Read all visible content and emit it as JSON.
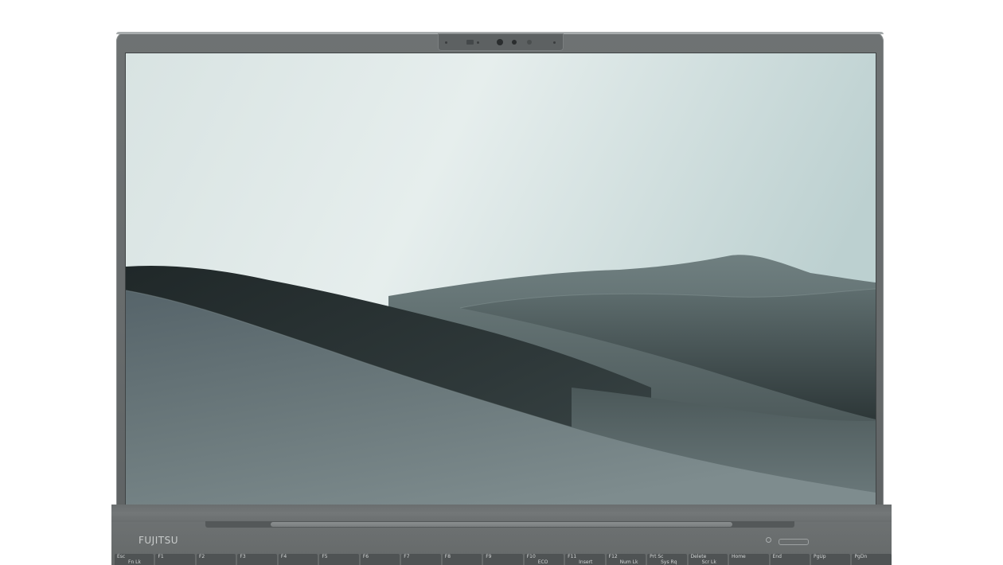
{
  "brand": "FUJITSU",
  "keyboard": {
    "keys": [
      {
        "top": "Esc",
        "bottom": "Fn Lk"
      },
      {
        "top": "F1",
        "bottom": ""
      },
      {
        "top": "F2",
        "bottom": ""
      },
      {
        "top": "F3",
        "bottom": ""
      },
      {
        "top": "F4",
        "bottom": ""
      },
      {
        "top": "F5",
        "bottom": ""
      },
      {
        "top": "F6",
        "bottom": ""
      },
      {
        "top": "F7",
        "bottom": ""
      },
      {
        "top": "F8",
        "bottom": ""
      },
      {
        "top": "F9",
        "bottom": ""
      },
      {
        "top": "F10",
        "bottom": "ECO"
      },
      {
        "top": "F11",
        "bottom": "Insert"
      },
      {
        "top": "F12",
        "bottom": "Num Lk"
      },
      {
        "top": "Prt Sc",
        "bottom": "Sys Rq"
      },
      {
        "top": "Delete",
        "bottom": "Scr Lk"
      },
      {
        "top": "Home",
        "bottom": ""
      },
      {
        "top": "End",
        "bottom": ""
      },
      {
        "top": "PgUp",
        "bottom": ""
      },
      {
        "top": "PgDn",
        "bottom": ""
      }
    ]
  },
  "colors": {
    "sky_light": "#e6eeee",
    "sky_dark": "#b9cccc",
    "dune_dark": "#2b3334",
    "dune_mid": "#4d5a5b",
    "dune_light": "#7b8a8b",
    "bezel": "#6a6e6f"
  }
}
